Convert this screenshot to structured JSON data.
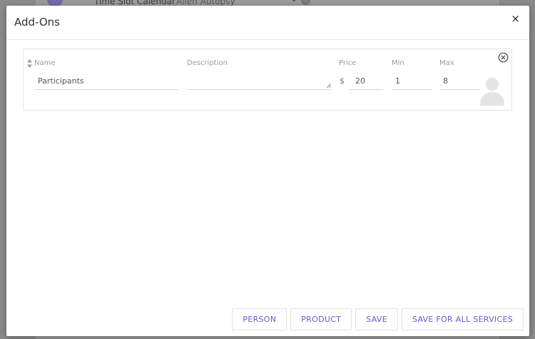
{
  "background": {
    "label_calendar": "Time Slot Calendar",
    "label_service": "Alien Autopsy",
    "help_glyph": "?"
  },
  "modal": {
    "title": "Add-Ons",
    "close_glyph": "×"
  },
  "addon": {
    "columns": {
      "name": "Name",
      "description": "Description",
      "price": "Price",
      "min": "Min",
      "max": "Max"
    },
    "name_value": "Participants",
    "description_value": "",
    "currency_symbol": "$",
    "price_value": "20",
    "min_value": "1",
    "max_value": "8"
  },
  "footer": {
    "person_label": "PERSON",
    "product_label": "PRODUCT",
    "save_label": "SAVE",
    "save_all_label": "SAVE FOR ALL SERVICES"
  },
  "colors": {
    "accent": "#6b57c9",
    "overlay": "#8a8a8a"
  }
}
